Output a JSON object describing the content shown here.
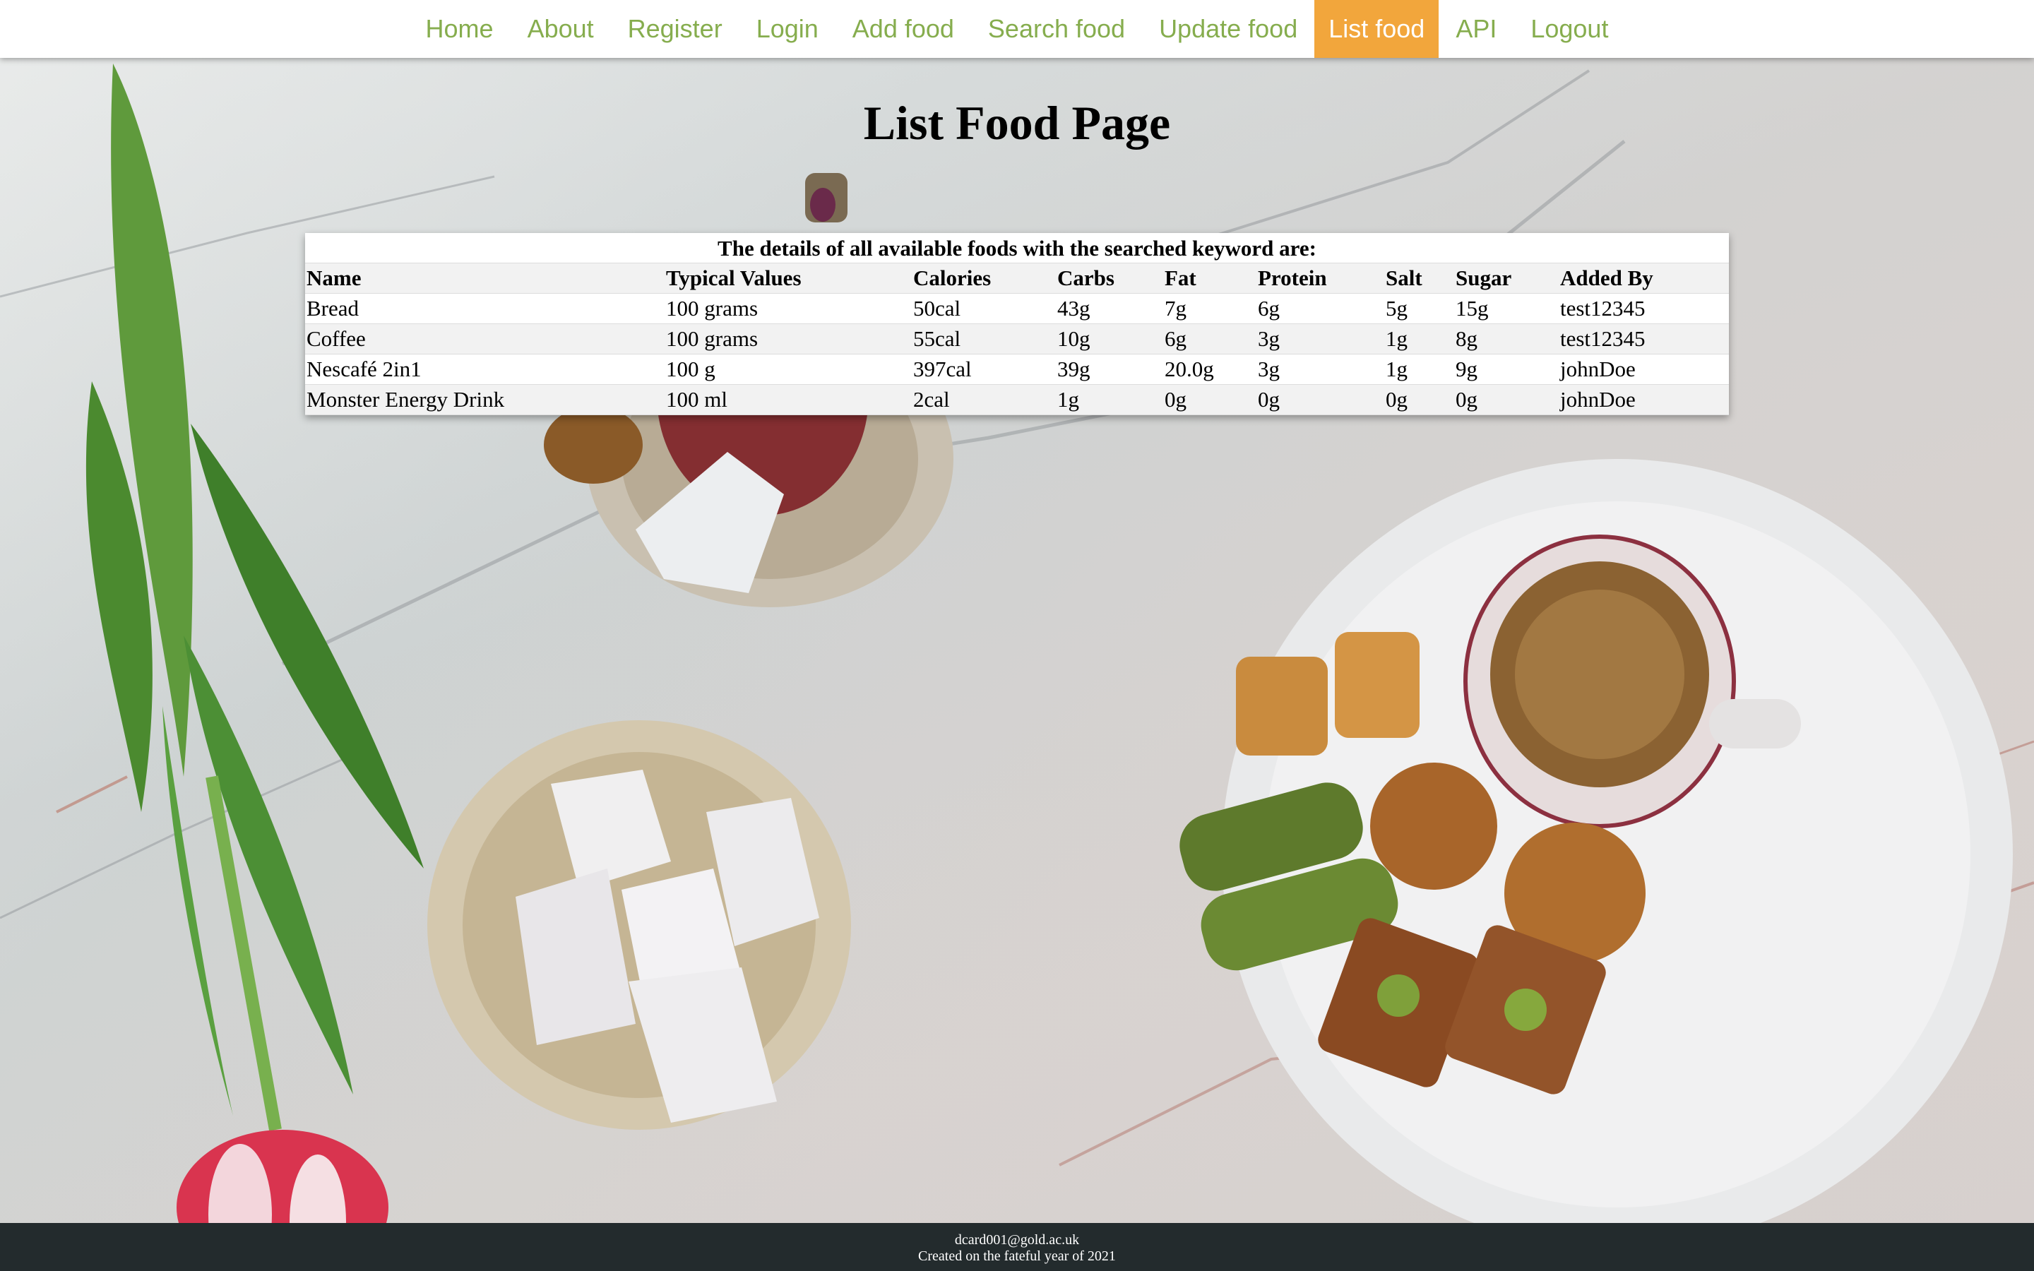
{
  "nav": {
    "items": [
      {
        "label": "Home"
      },
      {
        "label": "About"
      },
      {
        "label": "Register"
      },
      {
        "label": "Login"
      },
      {
        "label": "Add food"
      },
      {
        "label": "Search food"
      },
      {
        "label": "Update food"
      },
      {
        "label": "List food"
      },
      {
        "label": "API"
      },
      {
        "label": "Logout"
      }
    ],
    "active": "List food",
    "colors": {
      "link": "#86ad4e",
      "active_bg": "#f2a63c",
      "active_text": "#ffffff"
    }
  },
  "page": {
    "title": "List Food Page"
  },
  "table": {
    "caption": "The details of all available foods with the searched keyword are:",
    "headers": [
      "Name",
      "Typical Values",
      "Calories",
      "Carbs",
      "Fat",
      "Protein",
      "Salt",
      "Sugar",
      "Added By"
    ],
    "rows": [
      [
        "Bread",
        "100 grams",
        "50cal",
        "43g",
        "7g",
        "6g",
        "5g",
        "15g",
        "test12345"
      ],
      [
        "Coffee",
        "100 grams",
        "55cal",
        "10g",
        "6g",
        "3g",
        "1g",
        "8g",
        "test12345"
      ],
      [
        "Nescafé 2in1",
        "100 g",
        "397cal",
        "39g",
        "20.0g",
        "3g",
        "1g",
        "9g",
        "johnDoe"
      ],
      [
        "Monster Energy Drink",
        "100 ml",
        "2cal",
        "1g",
        "0g",
        "0g",
        "0g",
        "0g",
        "johnDoe"
      ]
    ]
  },
  "footer": {
    "email": "dcard001@gold.ac.uk",
    "note": "Created on the fateful year of 2021",
    "bg_color": "#232b2d"
  }
}
